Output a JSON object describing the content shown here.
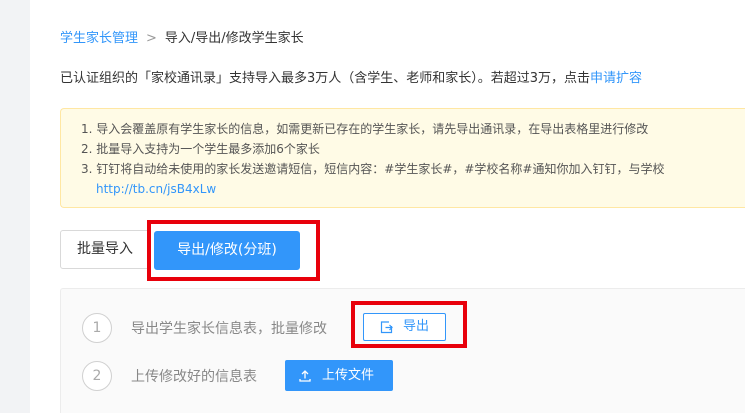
{
  "breadcrumb": {
    "parent": "学生家长管理",
    "separator": ">",
    "current": "导入/导出/修改学生家长"
  },
  "intro": {
    "text": "已认证组织的「家校通讯录」支持导入最多3万人（含学生、老师和家长）。若超过3万，点击",
    "link": "申请扩容"
  },
  "notice": {
    "lines": [
      "1. 导入会覆盖原有学生家长的信息，如需更新已存在的学生家长，请先导出通讯录，在导出表格里进行修改",
      "2. 批量导入支持为一个学生最多添加6个家长",
      "3. 钉钉将自动给未使用的家长发送邀请短信，短信内容：#学生家长#，#学校名称#通知你加入钉钉，与学校"
    ],
    "url": "http://tb.cn/jsB4xLw"
  },
  "tabs": {
    "batch_import": "批量导入",
    "export_modify": "导出/修改(分班)"
  },
  "steps": {
    "step1": {
      "number": "1",
      "text": "导出学生家长信息表，批量修改",
      "button": "导出"
    },
    "step2": {
      "number": "2",
      "text": "上传修改好的信息表",
      "button": "上传文件"
    }
  },
  "colors": {
    "accent": "#3296fa",
    "highlight_box": "#e8000b",
    "notice_bg": "#fffbe6"
  },
  "icons": {
    "export_button": "export-icon",
    "upload_button": "upload-icon"
  }
}
